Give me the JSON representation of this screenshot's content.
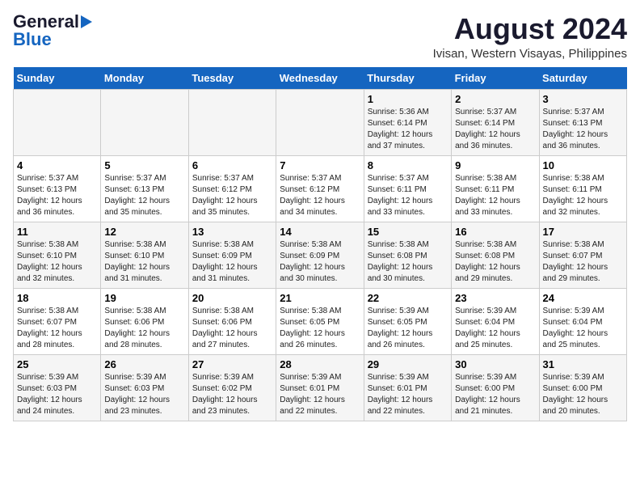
{
  "logo": {
    "line1": "General",
    "line2": "Blue"
  },
  "title": "August 2024",
  "subtitle": "Ivisan, Western Visayas, Philippines",
  "days_of_week": [
    "Sunday",
    "Monday",
    "Tuesday",
    "Wednesday",
    "Thursday",
    "Friday",
    "Saturday"
  ],
  "weeks": [
    [
      {
        "day": "",
        "info": ""
      },
      {
        "day": "",
        "info": ""
      },
      {
        "day": "",
        "info": ""
      },
      {
        "day": "",
        "info": ""
      },
      {
        "day": "1",
        "info": "Sunrise: 5:36 AM\nSunset: 6:14 PM\nDaylight: 12 hours\nand 37 minutes."
      },
      {
        "day": "2",
        "info": "Sunrise: 5:37 AM\nSunset: 6:14 PM\nDaylight: 12 hours\nand 36 minutes."
      },
      {
        "day": "3",
        "info": "Sunrise: 5:37 AM\nSunset: 6:13 PM\nDaylight: 12 hours\nand 36 minutes."
      }
    ],
    [
      {
        "day": "4",
        "info": "Sunrise: 5:37 AM\nSunset: 6:13 PM\nDaylight: 12 hours\nand 36 minutes."
      },
      {
        "day": "5",
        "info": "Sunrise: 5:37 AM\nSunset: 6:13 PM\nDaylight: 12 hours\nand 35 minutes."
      },
      {
        "day": "6",
        "info": "Sunrise: 5:37 AM\nSunset: 6:12 PM\nDaylight: 12 hours\nand 35 minutes."
      },
      {
        "day": "7",
        "info": "Sunrise: 5:37 AM\nSunset: 6:12 PM\nDaylight: 12 hours\nand 34 minutes."
      },
      {
        "day": "8",
        "info": "Sunrise: 5:37 AM\nSunset: 6:11 PM\nDaylight: 12 hours\nand 33 minutes."
      },
      {
        "day": "9",
        "info": "Sunrise: 5:38 AM\nSunset: 6:11 PM\nDaylight: 12 hours\nand 33 minutes."
      },
      {
        "day": "10",
        "info": "Sunrise: 5:38 AM\nSunset: 6:11 PM\nDaylight: 12 hours\nand 32 minutes."
      }
    ],
    [
      {
        "day": "11",
        "info": "Sunrise: 5:38 AM\nSunset: 6:10 PM\nDaylight: 12 hours\nand 32 minutes."
      },
      {
        "day": "12",
        "info": "Sunrise: 5:38 AM\nSunset: 6:10 PM\nDaylight: 12 hours\nand 31 minutes."
      },
      {
        "day": "13",
        "info": "Sunrise: 5:38 AM\nSunset: 6:09 PM\nDaylight: 12 hours\nand 31 minutes."
      },
      {
        "day": "14",
        "info": "Sunrise: 5:38 AM\nSunset: 6:09 PM\nDaylight: 12 hours\nand 30 minutes."
      },
      {
        "day": "15",
        "info": "Sunrise: 5:38 AM\nSunset: 6:08 PM\nDaylight: 12 hours\nand 30 minutes."
      },
      {
        "day": "16",
        "info": "Sunrise: 5:38 AM\nSunset: 6:08 PM\nDaylight: 12 hours\nand 29 minutes."
      },
      {
        "day": "17",
        "info": "Sunrise: 5:38 AM\nSunset: 6:07 PM\nDaylight: 12 hours\nand 29 minutes."
      }
    ],
    [
      {
        "day": "18",
        "info": "Sunrise: 5:38 AM\nSunset: 6:07 PM\nDaylight: 12 hours\nand 28 minutes."
      },
      {
        "day": "19",
        "info": "Sunrise: 5:38 AM\nSunset: 6:06 PM\nDaylight: 12 hours\nand 28 minutes."
      },
      {
        "day": "20",
        "info": "Sunrise: 5:38 AM\nSunset: 6:06 PM\nDaylight: 12 hours\nand 27 minutes."
      },
      {
        "day": "21",
        "info": "Sunrise: 5:38 AM\nSunset: 6:05 PM\nDaylight: 12 hours\nand 26 minutes."
      },
      {
        "day": "22",
        "info": "Sunrise: 5:39 AM\nSunset: 6:05 PM\nDaylight: 12 hours\nand 26 minutes."
      },
      {
        "day": "23",
        "info": "Sunrise: 5:39 AM\nSunset: 6:04 PM\nDaylight: 12 hours\nand 25 minutes."
      },
      {
        "day": "24",
        "info": "Sunrise: 5:39 AM\nSunset: 6:04 PM\nDaylight: 12 hours\nand 25 minutes."
      }
    ],
    [
      {
        "day": "25",
        "info": "Sunrise: 5:39 AM\nSunset: 6:03 PM\nDaylight: 12 hours\nand 24 minutes."
      },
      {
        "day": "26",
        "info": "Sunrise: 5:39 AM\nSunset: 6:03 PM\nDaylight: 12 hours\nand 23 minutes."
      },
      {
        "day": "27",
        "info": "Sunrise: 5:39 AM\nSunset: 6:02 PM\nDaylight: 12 hours\nand 23 minutes."
      },
      {
        "day": "28",
        "info": "Sunrise: 5:39 AM\nSunset: 6:01 PM\nDaylight: 12 hours\nand 22 minutes."
      },
      {
        "day": "29",
        "info": "Sunrise: 5:39 AM\nSunset: 6:01 PM\nDaylight: 12 hours\nand 22 minutes."
      },
      {
        "day": "30",
        "info": "Sunrise: 5:39 AM\nSunset: 6:00 PM\nDaylight: 12 hours\nand 21 minutes."
      },
      {
        "day": "31",
        "info": "Sunrise: 5:39 AM\nSunset: 6:00 PM\nDaylight: 12 hours\nand 20 minutes."
      }
    ]
  ]
}
